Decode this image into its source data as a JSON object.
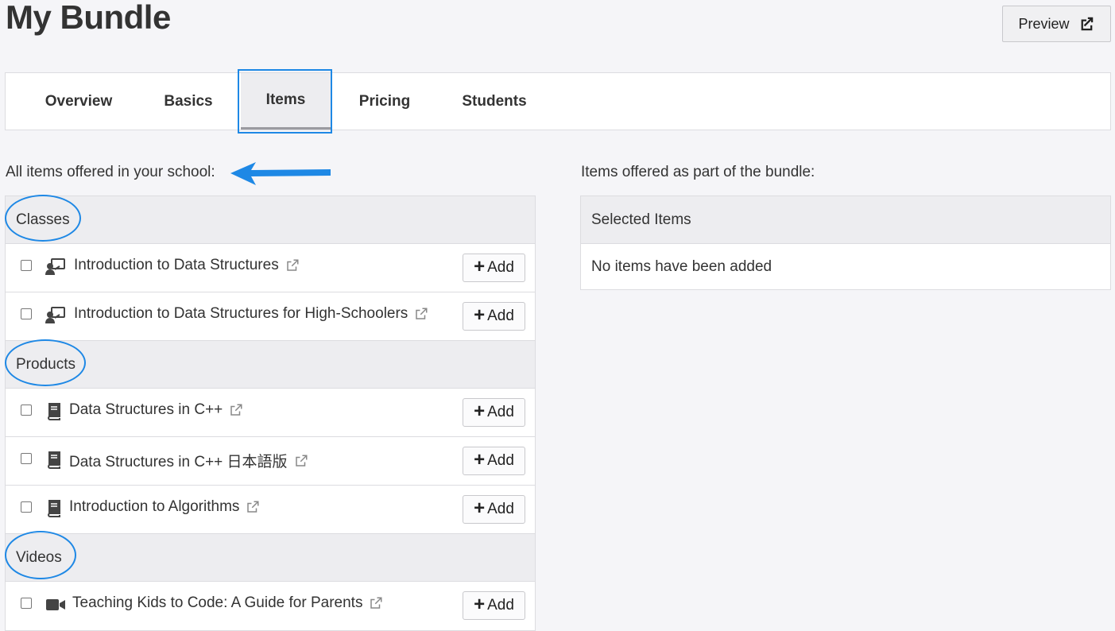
{
  "page": {
    "title": "My Bundle",
    "preview_label": "Preview"
  },
  "tabs": [
    {
      "label": "Overview"
    },
    {
      "label": "Basics"
    },
    {
      "label": "Items"
    },
    {
      "label": "Pricing"
    },
    {
      "label": "Students"
    }
  ],
  "left": {
    "heading": "All items offered in your school:",
    "groups": [
      {
        "title": "Classes",
        "items": [
          {
            "label": "Introduction to Data Structures",
            "icon": "classroom-icon",
            "add_label": "Add"
          },
          {
            "label": "Introduction to Data Structures for High-Schoolers",
            "icon": "classroom-icon",
            "add_label": "Add"
          }
        ]
      },
      {
        "title": "Products",
        "items": [
          {
            "label": "Data Structures in C++",
            "icon": "book-icon",
            "add_label": "Add"
          },
          {
            "label": "Data Structures in C++ 日本語版",
            "icon": "book-icon",
            "add_label": "Add"
          },
          {
            "label": "Introduction to Algorithms",
            "icon": "book-icon",
            "add_label": "Add"
          }
        ]
      },
      {
        "title": "Videos",
        "items": [
          {
            "label": "Teaching Kids to Code: A Guide for Parents",
            "icon": "video-camera-icon",
            "add_label": "Add"
          }
        ]
      }
    ]
  },
  "right": {
    "heading": "Items offered as part of the bundle:",
    "panel_title": "Selected Items",
    "empty_text": "No items have been added"
  },
  "colors": {
    "annotation": "#1e88e5",
    "background": "#f5f5f8",
    "header_bg": "#ededf0"
  }
}
